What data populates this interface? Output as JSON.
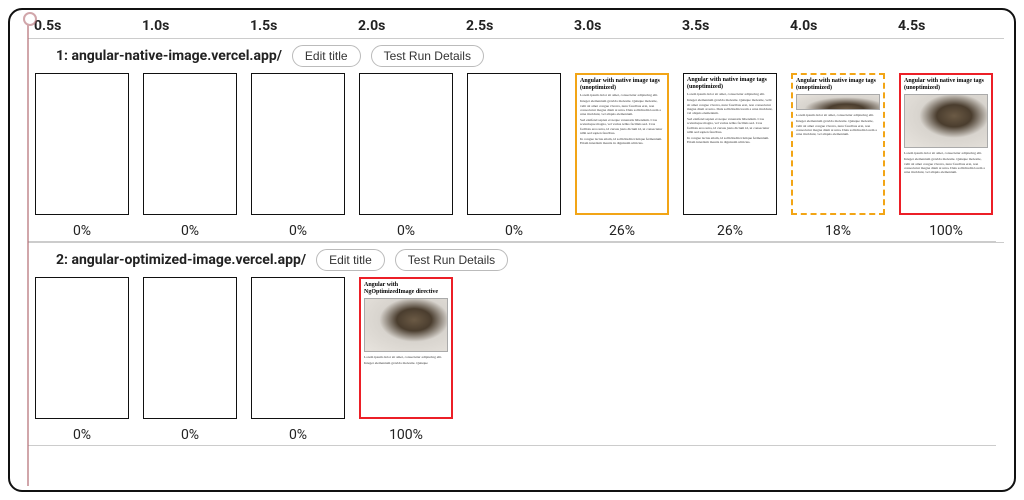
{
  "timeline_ticks": [
    "0.5s",
    "1.0s",
    "1.5s",
    "2.0s",
    "2.5s",
    "3.0s",
    "3.5s",
    "4.0s",
    "4.5s"
  ],
  "rows": [
    {
      "title": "1: angular-native-image.vercel.app/",
      "edit_label": "Edit title",
      "details_label": "Test Run Details",
      "frames": [
        {
          "pct": "0%",
          "variant": "blank"
        },
        {
          "pct": "0%",
          "variant": "blank"
        },
        {
          "pct": "0%",
          "variant": "blank"
        },
        {
          "pct": "0%",
          "variant": "blank"
        },
        {
          "pct": "0%",
          "variant": "blank"
        },
        {
          "pct": "26%",
          "variant": "text",
          "border": "b-orange"
        },
        {
          "pct": "26%",
          "variant": "text",
          "border": ""
        },
        {
          "pct": "18%",
          "variant": "partial",
          "border": "b-orange-dashed"
        },
        {
          "pct": "100%",
          "variant": "full",
          "border": "b-red"
        }
      ],
      "frame_title": "Angular with native image tags (unoptimized)",
      "lorem1": "Lorem ipsum dolor sit amet, consectetur adipiscing elit.",
      "lorem2": "Integer elementum gravida molestie. Quisque molestie, velit sit amet congue viverra, nunc faucibus erat, non consectetur magna diam at urna. Duis sollicitudin lorem a urna tincidunt, vel aliquis elementum.",
      "lorem3": "Sed eleifend sapien et neque venenatis bibendum. Cras scelerisque magna, vel varius tellus facilisis sed. Cras facilisis eros urna, id cursus justo dictum id, ut consectetur nibh sed sapien faucibus.",
      "lorem4": "In congue lectus etiam, id sollicitudin tristique fermentum. Etiam interdum mauris in dignissim ultricies."
    },
    {
      "title": "2: angular-optimized-image.vercel.app/",
      "edit_label": "Edit title",
      "details_label": "Test Run Details",
      "frames": [
        {
          "pct": "0%",
          "variant": "blank"
        },
        {
          "pct": "0%",
          "variant": "blank"
        },
        {
          "pct": "0%",
          "variant": "blank"
        },
        {
          "pct": "100%",
          "variant": "full",
          "border": "b-red"
        }
      ],
      "frame_title": "Angular with NgOptimizedImage directive",
      "lorem1": "Lorem ipsum dolor sit amet, consectetur adipiscing elit.",
      "lorem2": "Integer elementum gravida molestie. Quisque"
    }
  ]
}
